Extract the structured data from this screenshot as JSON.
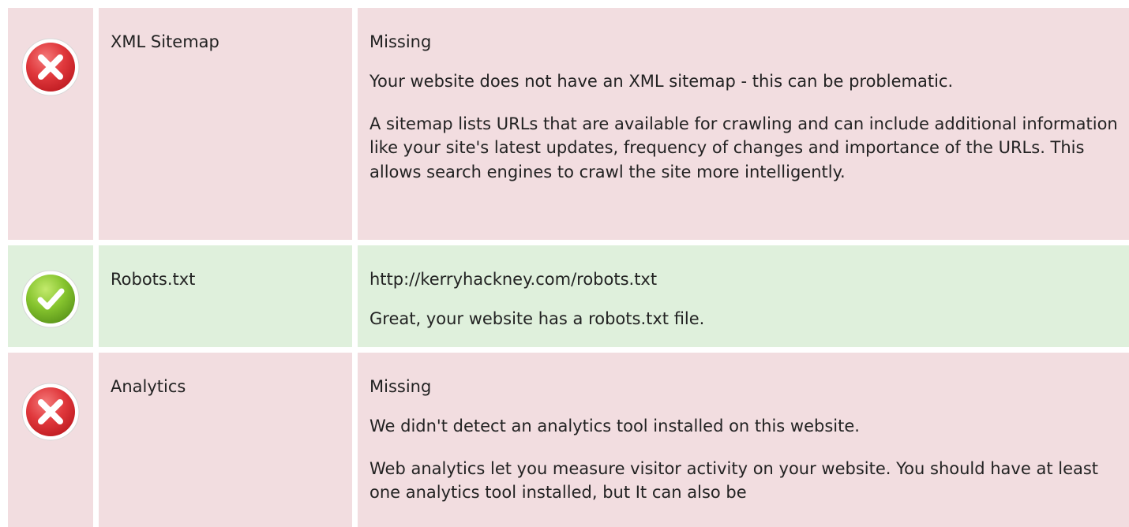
{
  "rows": [
    {
      "status": "fail",
      "icon": "error-x-icon",
      "name": "XML Sitemap",
      "value": "Missing",
      "paragraphs": [
        "Your website does not have an XML sitemap - this can be problematic.",
        "A sitemap lists URLs that are available for crawling and can include additional information like your site's latest updates, frequency of changes and importance of the URLs. This allows search engines to crawl the site more intelligently."
      ]
    },
    {
      "status": "pass",
      "icon": "success-check-icon",
      "name": "Robots.txt",
      "value": "http://kerryhackney.com/robots.txt",
      "paragraphs": [
        "Great, your website has a robots.txt file."
      ]
    },
    {
      "status": "fail",
      "icon": "error-x-icon",
      "name": "Analytics",
      "value": "Missing",
      "paragraphs": [
        "We didn't detect an analytics tool installed on this website.",
        "Web analytics let you measure visitor activity on your website. You should have at least one analytics tool installed, but It can also be"
      ]
    }
  ],
  "colors": {
    "fail_background": "#f2dde0",
    "pass_background": "#dff0dc",
    "fail_icon": "#e0383c",
    "pass_icon": "#86c42e"
  }
}
